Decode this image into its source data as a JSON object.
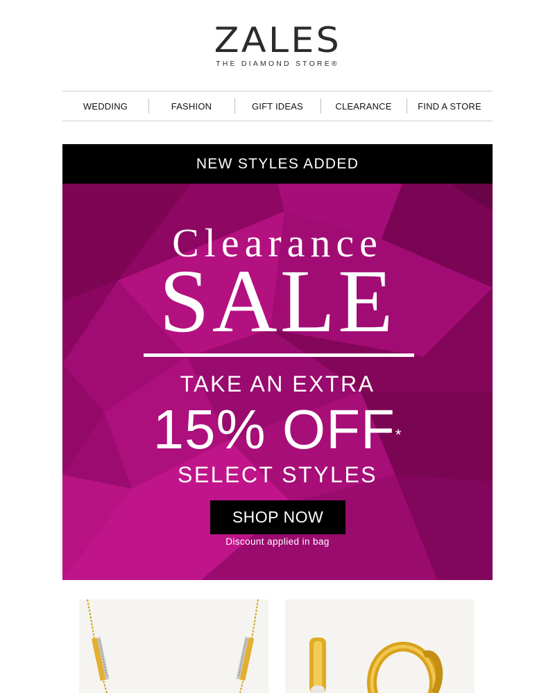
{
  "brand": {
    "name": "ZALES",
    "tagline": "THE DIAMOND STORE®"
  },
  "nav": {
    "items": [
      {
        "label": "WEDDING"
      },
      {
        "label": "FASHION"
      },
      {
        "label": "GIFT IDEAS"
      },
      {
        "label": "CLEARANCE"
      },
      {
        "label": "FIND A STORE"
      }
    ]
  },
  "banner": {
    "text": "NEW STYLES ADDED"
  },
  "hero": {
    "title_line1": "Clearance",
    "title_line2": "SALE",
    "offer_line1": "TAKE AN EXTRA",
    "offer_line2": "15% OFF",
    "offer_mark": "*",
    "offer_line3": "SELECT STYLES",
    "cta": "SHOP NOW",
    "note": "Discount applied in bag",
    "background_color": "#9d0a72"
  },
  "products": [
    {
      "icon": "gold-bar-necklace-image"
    },
    {
      "icon": "gold-hoop-earrings-image"
    }
  ],
  "colors": {
    "black": "#000000",
    "magenta": "#9d0a72",
    "gold": "#d9a520"
  }
}
